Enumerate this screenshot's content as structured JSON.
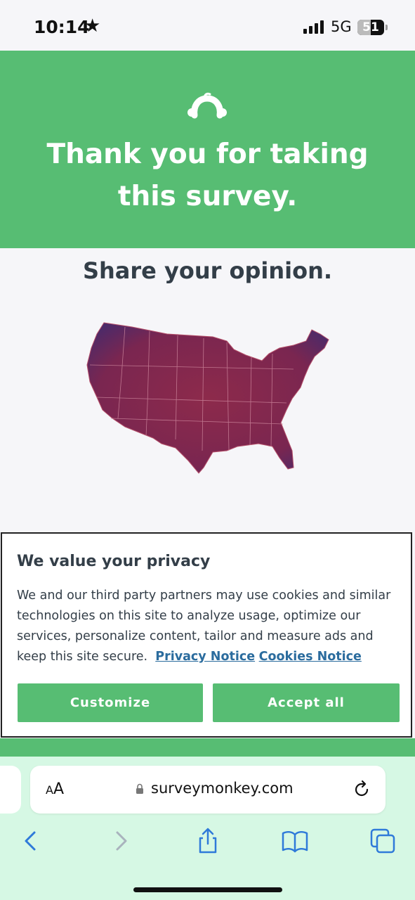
{
  "status": {
    "time": "10:14",
    "network": "5G",
    "battery": "51"
  },
  "header": {
    "title": "Thank you for taking this survey."
  },
  "main": {
    "share_heading": "Share your opinion."
  },
  "privacy": {
    "title": "We value your privacy",
    "body": "We and our third party partners may use cookies and similar technologies on this site to analyze usage, optimize our services, personalize content, tailor and measure ads and keep this site secure.",
    "privacy_link": "Privacy Notice",
    "cookies_link": "Cookies Notice",
    "customize_label": "Customize",
    "accept_label": "Accept all"
  },
  "browser": {
    "aa_small": "A",
    "aa_large": "A",
    "url": "surveymonkey.com"
  },
  "colors": {
    "brand_green": "#57bd73",
    "link_blue": "#2b6c9e",
    "text_dark": "#333e48",
    "map_red": "#8a2a4e"
  },
  "icons": [
    "star-icon",
    "signal-icon",
    "battery-icon",
    "surveymonkey-logo-icon",
    "lock-icon",
    "reload-icon",
    "back-icon",
    "forward-icon",
    "share-icon",
    "bookmarks-icon",
    "tabs-icon"
  ]
}
